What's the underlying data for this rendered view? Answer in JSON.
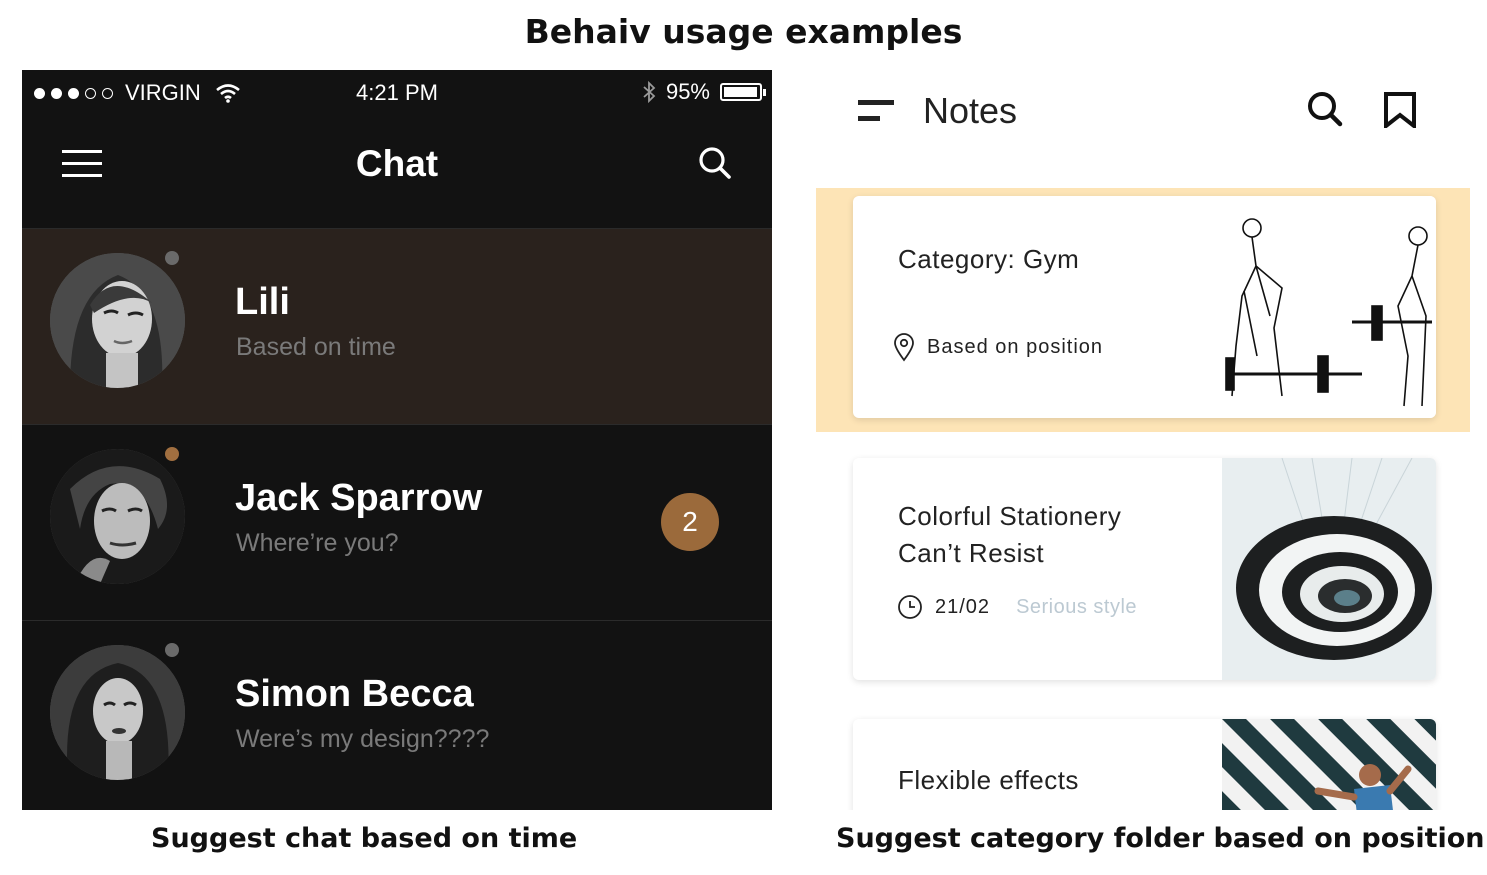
{
  "page_title": "Behaiv usage examples",
  "captions": {
    "left": "Suggest chat based on time",
    "right": "Suggest category folder based on position"
  },
  "chat_app": {
    "status_bar": {
      "carrier": "VIRGIN",
      "time": "4:21 PM",
      "battery": "95%",
      "signal_dots_filled": 3,
      "signal_dots_total": 5
    },
    "title": "Chat",
    "items": [
      {
        "name": "Lili",
        "subtitle": "Based on time",
        "highlighted": true,
        "presence_color": "#6a6a6a"
      },
      {
        "name": "Jack Sparrow",
        "subtitle": "Where’re you?",
        "unread": "2",
        "presence_color": "#a16f40"
      },
      {
        "name": "Simon Becca",
        "subtitle": "Were’s my design????",
        "presence_color": "#6a6a6a"
      }
    ],
    "colors": {
      "background": "#121212",
      "highlight": "#2a221d",
      "badge": "#9b6a3b"
    }
  },
  "notes_app": {
    "title": "Notes",
    "cards": [
      {
        "title": "Category: Gym",
        "meta": "Based on position",
        "meta_icon": "location-pin-icon",
        "highlighted": true
      },
      {
        "title_lines": [
          "Colorful Stationery",
          "Can’t Resist"
        ],
        "date": "21/02",
        "tag": "Serious style",
        "meta_icon": "clock-icon"
      },
      {
        "title": "Flexible effects"
      }
    ],
    "colors": {
      "highlight_band": "#fde4b6",
      "tag": "#bcc9d2"
    }
  }
}
